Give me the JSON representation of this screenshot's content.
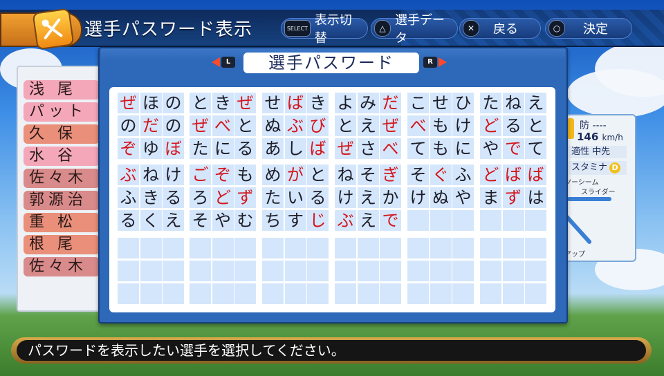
{
  "header": {
    "title": "選手パスワード表示",
    "controls": [
      {
        "glyph": "SELECT",
        "label": "表示切替"
      },
      {
        "glyph": "△",
        "label": "選手データ"
      },
      {
        "glyph": "✕",
        "label": "戻る"
      },
      {
        "glyph": "○",
        "label": "決定"
      }
    ]
  },
  "dialog": {
    "title": "選手パスワード",
    "prev_key": "L",
    "next_key": "R"
  },
  "password": {
    "blocks": [
      {
        "rows": [
          [
            {
              "c": "ぜ",
              "r": true
            },
            {
              "c": "ほ"
            },
            {
              "c": "の"
            }
          ],
          [
            {
              "c": "の"
            },
            {
              "c": "だ",
              "r": true
            },
            {
              "c": "の"
            }
          ],
          [
            {
              "c": "ぞ",
              "r": true
            },
            {
              "c": "ゆ"
            },
            {
              "c": "ぼ",
              "r": true
            }
          ],
          [
            {
              "c": "ぶ",
              "r": true
            },
            {
              "c": "ね"
            },
            {
              "c": "け"
            }
          ],
          [
            {
              "c": "ふ"
            },
            {
              "c": "き"
            },
            {
              "c": "る"
            }
          ],
          [
            {
              "c": "る"
            },
            {
              "c": "く"
            },
            {
              "c": "え"
            }
          ],
          [],
          [],
          []
        ]
      },
      {
        "rows": [
          [
            {
              "c": "と"
            },
            {
              "c": "き"
            },
            {
              "c": "ぜ",
              "r": true
            }
          ],
          [
            {
              "c": "ぜ",
              "r": true
            },
            {
              "c": "べ",
              "r": true
            },
            {
              "c": "と"
            }
          ],
          [
            {
              "c": "た"
            },
            {
              "c": "に"
            },
            {
              "c": "る"
            }
          ],
          [
            {
              "c": "ご",
              "r": true
            },
            {
              "c": "ぞ",
              "r": true
            },
            {
              "c": "も"
            }
          ],
          [
            {
              "c": "ろ"
            },
            {
              "c": "ど",
              "r": true
            },
            {
              "c": "ず",
              "r": true
            }
          ],
          [
            {
              "c": "そ"
            },
            {
              "c": "や"
            },
            {
              "c": "む"
            }
          ],
          [],
          [],
          []
        ]
      },
      {
        "rows": [
          [
            {
              "c": "せ"
            },
            {
              "c": "ば",
              "r": true
            },
            {
              "c": "き"
            }
          ],
          [
            {
              "c": "ぬ"
            },
            {
              "c": "ぶ",
              "r": true
            },
            {
              "c": "び",
              "r": true
            }
          ],
          [
            {
              "c": "あ"
            },
            {
              "c": "し"
            },
            {
              "c": "ば",
              "r": true
            }
          ],
          [
            {
              "c": "め"
            },
            {
              "c": "が",
              "r": true
            },
            {
              "c": "と"
            }
          ],
          [
            {
              "c": "た"
            },
            {
              "c": "い"
            },
            {
              "c": "る"
            }
          ],
          [
            {
              "c": "ち"
            },
            {
              "c": "す"
            },
            {
              "c": "じ",
              "r": true
            }
          ],
          [],
          [],
          []
        ]
      },
      {
        "rows": [
          [
            {
              "c": "よ"
            },
            {
              "c": "み"
            },
            {
              "c": "だ",
              "r": true
            }
          ],
          [
            {
              "c": "と"
            },
            {
              "c": "え"
            },
            {
              "c": "ぜ",
              "r": true
            }
          ],
          [
            {
              "c": "ぜ",
              "r": true
            },
            {
              "c": "さ"
            },
            {
              "c": "べ",
              "r": true
            }
          ],
          [
            {
              "c": "ね"
            },
            {
              "c": "そ"
            },
            {
              "c": "ぎ",
              "r": true
            }
          ],
          [
            {
              "c": "け"
            },
            {
              "c": "え"
            },
            {
              "c": "か"
            }
          ],
          [
            {
              "c": "ぶ",
              "r": true
            },
            {
              "c": "え"
            },
            {
              "c": "で",
              "r": true
            }
          ],
          [],
          [],
          []
        ]
      },
      {
        "rows": [
          [
            {
              "c": "こ"
            },
            {
              "c": "せ"
            },
            {
              "c": "ひ"
            }
          ],
          [
            {
              "c": "べ",
              "r": true
            },
            {
              "c": "も"
            },
            {
              "c": "け"
            }
          ],
          [
            {
              "c": "て"
            },
            {
              "c": "も"
            },
            {
              "c": "に"
            }
          ],
          [
            {
              "c": "そ"
            },
            {
              "c": "ぐ",
              "r": true
            },
            {
              "c": "ふ"
            }
          ],
          [
            {
              "c": "け"
            },
            {
              "c": "ぬ"
            },
            {
              "c": "や"
            }
          ],
          [],
          [],
          [],
          []
        ]
      },
      {
        "rows": [
          [
            {
              "c": "た"
            },
            {
              "c": "ね"
            },
            {
              "c": "え"
            }
          ],
          [
            {
              "c": "ど",
              "r": true
            },
            {
              "c": "る"
            },
            {
              "c": "と"
            }
          ],
          [
            {
              "c": "や"
            },
            {
              "c": "で",
              "r": true
            },
            {
              "c": "て"
            }
          ],
          [
            {
              "c": "ど",
              "r": true
            },
            {
              "c": "ば",
              "r": true
            },
            {
              "c": "ば",
              "r": true
            }
          ],
          [
            {
              "c": "ま"
            },
            {
              "c": "ず",
              "r": true
            },
            {
              "c": "は"
            }
          ],
          [],
          [],
          [],
          []
        ]
      }
    ]
  },
  "player_list": [
    {
      "name": "浅 尾",
      "color": "#f3a7b9"
    },
    {
      "name": "パット",
      "color": "#f3a7b9"
    },
    {
      "name": "久 保",
      "color": "#e98f7a"
    },
    {
      "name": "水 谷",
      "color": "#f3a7b9"
    },
    {
      "name": "佐々木",
      "color": "#d98a8a"
    },
    {
      "name": "郭源治",
      "color": "#d98a8a"
    },
    {
      "name": "重 松",
      "color": "#e98f7a"
    },
    {
      "name": "根 尾",
      "color": "#e98f7a"
    },
    {
      "name": "佐々木",
      "color": "#d98a8a"
    }
  ],
  "player_card": {
    "defense_label": "防 ----",
    "speed": "146",
    "speed_unit": "km/h",
    "aptitude_label": "適性",
    "aptitude_value": "中先",
    "stamina_label": "スタミナ",
    "stamina_grade": "D",
    "pitch_1": "ツーシーム",
    "pitch_2": "スライダー",
    "footer": "アップ"
  },
  "message": "パスワードを表示したい選手を選択してください。"
}
